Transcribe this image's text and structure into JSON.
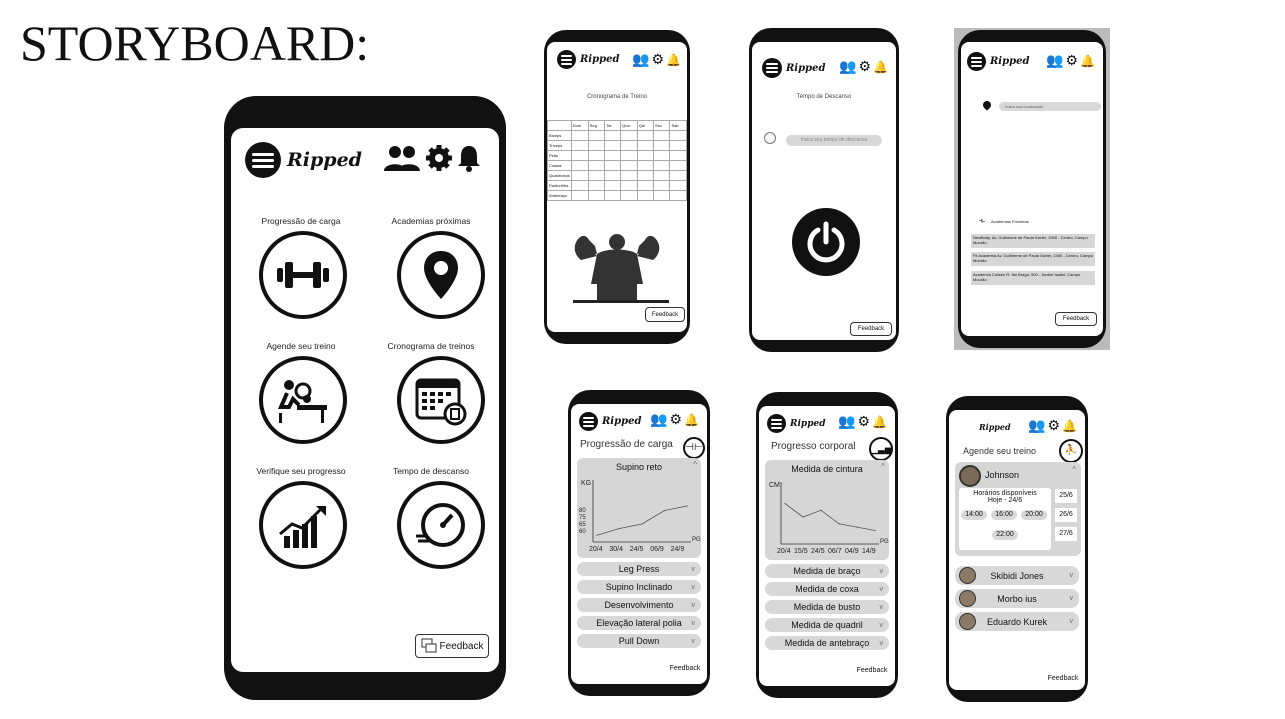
{
  "storyboard_title": "STORYBOARD:",
  "brand": "Ripped",
  "feedback": "Feedback",
  "home": {
    "items": [
      {
        "label": "Progressão de carga"
      },
      {
        "label": "Academias próximas"
      },
      {
        "label": "Agende seu treino"
      },
      {
        "label": "Cronograma de treinos"
      },
      {
        "label": "Verifique seu progresso"
      },
      {
        "label": "Tempo de descanso"
      }
    ]
  },
  "schedule": {
    "title": "Cronograma de Treino",
    "days": [
      "Dom",
      "Seg",
      "Ter",
      "Qua",
      "Qui",
      "Sex",
      "Sab"
    ],
    "rows": [
      "Bíceps",
      "Tríceps",
      "Peito",
      "Costas",
      "Quadríceps",
      "Panturrilha",
      "Antebraço"
    ]
  },
  "rest": {
    "title": "Tempo de Descanso",
    "placeholder": "Insira seu tempo de descanso"
  },
  "gyms": {
    "placeholder": "Insira sua localização",
    "list_title": "Academias Próximas",
    "list": [
      "NewBody, Av. Guilherme de Paula Xavier, 1900 - Centro, Campo Mourão",
      "Fit Academia Av. Guilherme de Paula Xavier, 2400 - Centro, Campo Mourão",
      "Academia Coliseu R. Itaí Braga, 900 - Jardim Isabel, Campo Mourão"
    ]
  },
  "load": {
    "title": "Progressão de carga",
    "card_title": "Supino reto",
    "ylabel": "KG",
    "xlabel": "PG",
    "items": [
      "Leg Press",
      "Supino Inclinado",
      "Desenvolvimento",
      "Elevação lateral polia",
      "Pull Down"
    ]
  },
  "body": {
    "title": "Progresso corporal",
    "card_title": "Medida de cintura",
    "ylabel": "CM",
    "xlabel": "PG",
    "items": [
      "Medida de braço",
      "Medida de coxa",
      "Medida de busto",
      "Medida de quadril",
      "Medida de antebraço"
    ]
  },
  "book": {
    "title": "Agende seu treino",
    "trainer": "Johnson",
    "slots_title": "Horários disponíveis",
    "slots_date": "Hoje - 24/6",
    "times": [
      "14:00",
      "16:00",
      "20:00",
      "22:00"
    ],
    "dates": [
      "25/6",
      "26/6",
      "27/6"
    ],
    "others": [
      "Skibidi Jones",
      "Morbo ius",
      "Eduardo Kurek"
    ]
  },
  "chart_data": [
    {
      "type": "line",
      "title": "Supino reto",
      "ylabel": "KG",
      "xlabel": "PG",
      "x": [
        "20/4",
        "30/4",
        "24/5",
        "06/9",
        "24/9"
      ],
      "y_ticks": [
        "80",
        "75",
        "65",
        "60"
      ],
      "values": [
        61,
        64,
        66,
        72,
        74
      ],
      "ylim": [
        58,
        82
      ]
    },
    {
      "type": "line",
      "title": "Medida de cintura",
      "ylabel": "CM",
      "xlabel": "PG",
      "x": [
        "20/4",
        "15/5",
        "24/5",
        "06/7",
        "04/9",
        "14/9"
      ],
      "values": [
        80,
        76,
        78,
        74,
        73,
        72
      ],
      "ylim": [
        68,
        84
      ]
    }
  ]
}
